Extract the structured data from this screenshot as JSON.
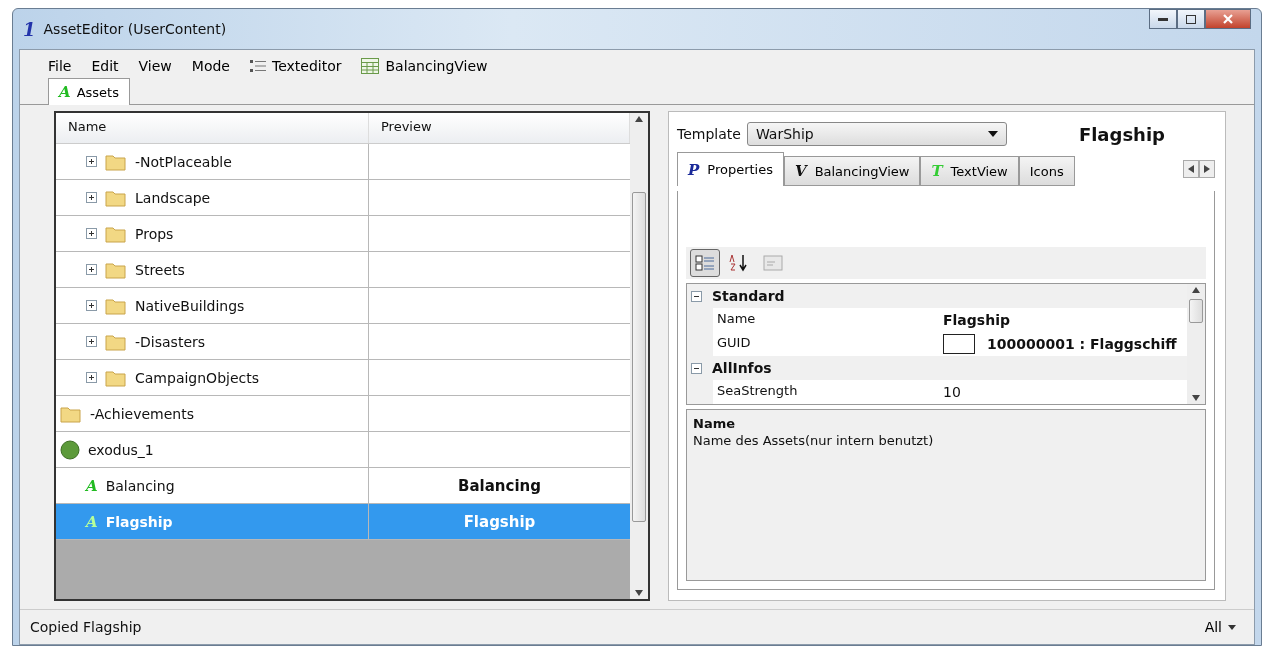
{
  "window": {
    "icon_glyph": "1",
    "title": "AssetEditor (UserContent)"
  },
  "menu": [
    {
      "kind": "text",
      "label": "File"
    },
    {
      "kind": "text",
      "label": "Edit"
    },
    {
      "kind": "text",
      "label": "View"
    },
    {
      "kind": "text",
      "label": "Mode"
    },
    {
      "kind": "list",
      "label": "Texteditor"
    },
    {
      "kind": "grid",
      "label": "BalancingView"
    }
  ],
  "doc_tabs": [
    {
      "glyph": "A",
      "label": "Assets",
      "selected": true
    }
  ],
  "tree": {
    "columns": [
      "Name",
      "Preview"
    ],
    "scrolled_children": [
      {
        "kind": "folder",
        "name": "-NotPlaceable",
        "expanded": false
      },
      {
        "kind": "folder",
        "name": "Landscape",
        "expanded": false
      },
      {
        "kind": "folder",
        "name": "Props",
        "expanded": false
      },
      {
        "kind": "folder",
        "name": "Streets",
        "expanded": false
      },
      {
        "kind": "folder",
        "name": "NativeBuildings",
        "expanded": false
      },
      {
        "kind": "folder",
        "name": "-Disasters",
        "expanded": false
      },
      {
        "kind": "folder",
        "name": "CampaignObjects",
        "expanded": false
      }
    ],
    "items": [
      {
        "kind": "folder",
        "name": "-Achievements"
      },
      {
        "kind": "world",
        "name": "exodus_1",
        "children": [
          {
            "kind": "asset",
            "glyph": "A",
            "name": "Balancing",
            "preview": "Balancing",
            "selected": false
          },
          {
            "kind": "asset",
            "glyph": "A",
            "name": "Flagship",
            "preview": "Flagship",
            "selected": true
          }
        ]
      }
    ]
  },
  "template": {
    "label": "Template",
    "value": "WarShip",
    "asset_name": "Flagship"
  },
  "tabs": [
    {
      "glyph": "P",
      "label": "Properties",
      "selected": true
    },
    {
      "glyph": "V",
      "label": "BalancingView",
      "selected": false
    },
    {
      "glyph": "T",
      "label": "TextView",
      "selected": false
    },
    {
      "label": "Icons",
      "selected": false
    }
  ],
  "property_grid": {
    "categorized": true,
    "sections": [
      {
        "title": "Standard",
        "expanded": true,
        "rows": [
          {
            "name": "Name",
            "value": "Flagship"
          },
          {
            "name": "GUID",
            "kind": "swatch",
            "value": "100000001 : Flaggschiff"
          }
        ]
      },
      {
        "title": "AllInfos",
        "expanded": true,
        "rows": [
          {
            "name": "SeaStrength",
            "value": "10"
          }
        ]
      }
    ],
    "help_title": "Name",
    "help_text": "Name des Assets(nur intern benutzt)"
  },
  "status_bar": {
    "message": "Copied Flagship",
    "filter": "All"
  }
}
